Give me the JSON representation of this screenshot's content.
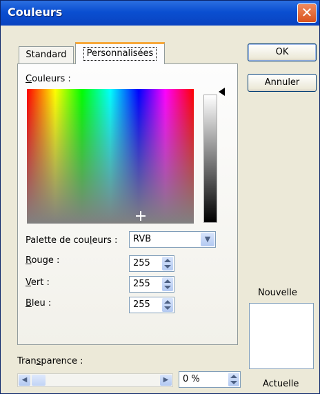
{
  "window": {
    "title": "Couleurs"
  },
  "tabs": [
    {
      "label": "Standard",
      "active": false
    },
    {
      "label": "Personnalisées",
      "active": true
    }
  ],
  "color_picker": {
    "label_accel": "C",
    "label_rest": "ouleurs :"
  },
  "palette": {
    "label_pre": "Palette de cou",
    "label_accel": "l",
    "label_post": "eurs :",
    "value": "RVB",
    "dropdown_icon": "chevron-down-icon"
  },
  "channels": {
    "red": {
      "label_accel": "R",
      "label_rest": "ouge :",
      "value": "255"
    },
    "green": {
      "label_accel": "V",
      "label_rest": "ert :",
      "value": "255"
    },
    "blue": {
      "label_accel": "B",
      "label_rest": "leu :",
      "value": "255"
    }
  },
  "transparency": {
    "label_pre": "Tran",
    "label_accel": "s",
    "label_post": "parence :",
    "value": "0 %",
    "level": 0
  },
  "buttons": {
    "ok": "OK",
    "cancel": "Annuler"
  },
  "preview": {
    "new_label": "Nouvelle",
    "current_label": "Actuelle",
    "new_color": "#ffffff",
    "current_color": "#ffffff"
  },
  "colors": {
    "titlebar": "#0a4fd1",
    "dialog_bg": "#ece9d8",
    "tab_highlight": "#f7a83a"
  }
}
